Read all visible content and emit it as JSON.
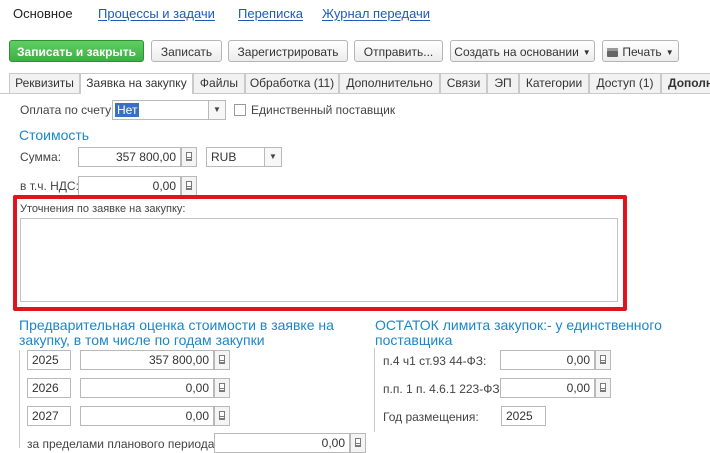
{
  "nav": {
    "tabs": [
      "Основное",
      "Процессы и задачи",
      "Переписка",
      "Журнал передачи"
    ]
  },
  "toolbar": {
    "save_close": "Записать и закрыть",
    "save": "Записать",
    "register": "Зарегистрировать",
    "send": "Отправить...",
    "create_based": "Создать на основании",
    "print": "Печать"
  },
  "form_tabs": [
    "Реквизиты",
    "Заявка на закупку",
    "Файлы",
    "Обработка (11)",
    "Дополнительно",
    "Связи",
    "ЭП",
    "Категории",
    "Доступ (1)",
    "Дополн"
  ],
  "payment": {
    "label": "Оплата по счету:",
    "value": "Нет",
    "single_supplier_label": "Единственный поставщик",
    "single_supplier_checked": false
  },
  "cost": {
    "title": "Стоимость",
    "sum_label": "Сумма:",
    "sum_value": "357 800,00",
    "currency": "RUB",
    "vat_label": "в т.ч. НДС:",
    "vat_value": "0,00"
  },
  "clarifications": {
    "label": "Уточнения по заявке на закупку:",
    "value": ""
  },
  "estimate": {
    "title": "Предварительная оценка стоимости в заявке на закупку, в том числе по годам закупки",
    "rows": [
      {
        "year": "2025",
        "value": "357 800,00"
      },
      {
        "year": "2026",
        "value": "0,00"
      },
      {
        "year": "2027",
        "value": "0,00"
      }
    ],
    "beyond_label": "за пределами планового периода:",
    "beyond_value": "0,00"
  },
  "limit": {
    "title": "ОСТАТОК лимита закупок:- у единственного поставщика",
    "row1_label": "п.4 ч1 ст.93 44-ФЗ:",
    "row1_value": "0,00",
    "row2_label": "п.п. 1 п. 4.6.1 223-ФЗ:",
    "row2_value": "0,00",
    "year_label": "Год размещения:",
    "year_value": "2025"
  },
  "colors": {
    "accent": "#1c86c8",
    "link": "#1e5bb8",
    "primary_button": "#3fae45",
    "highlight": "#e0141e"
  }
}
